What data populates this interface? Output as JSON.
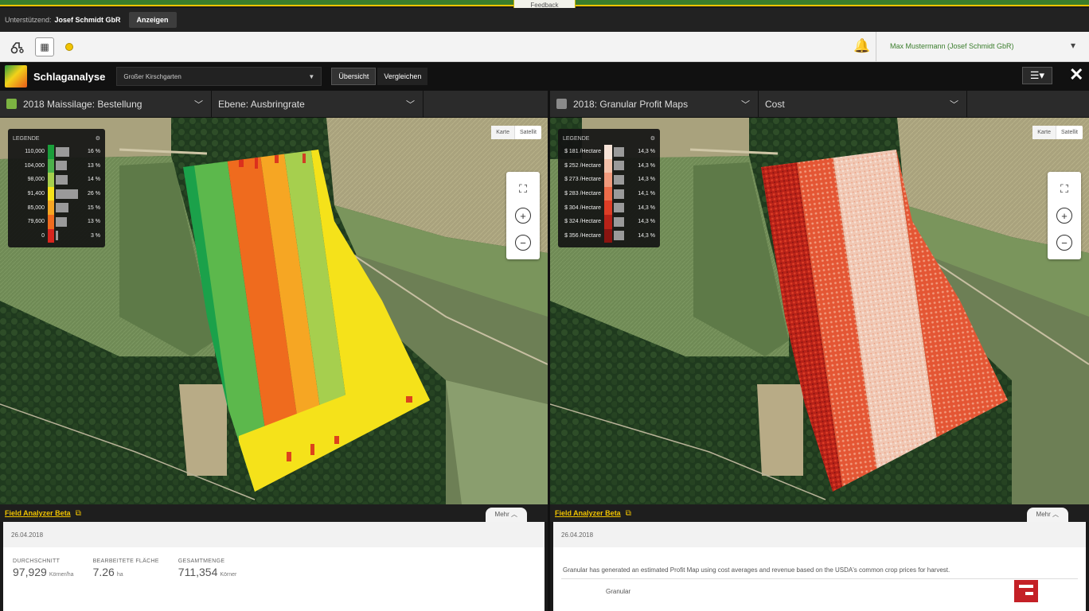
{
  "header": {
    "feedback_label": "Feedback",
    "support_label": "Unterstützend:",
    "org_name": "Josef Schmidt GbR",
    "open_button": "Anzeigen"
  },
  "toolbar": {
    "user": "Max Mustermann (Josef Schmidt GbR)"
  },
  "app": {
    "title": "Schlaganalyse",
    "field_select": "Großer Kirschgarten",
    "tab_overview": "Übersicht",
    "tab_compare": "Vergleichen"
  },
  "left_pane": {
    "layer": "2018 Maissilage: Bestellung",
    "layer_color": "#7cb342",
    "level": "Ebene: Ausbringrate",
    "map_toggle": [
      "Karte",
      "Satellit"
    ],
    "legend": {
      "title": "LEGENDE",
      "rows": [
        {
          "label": "110,000",
          "color": "#1a9e3a",
          "pct_text": "16 %",
          "pct": 16
        },
        {
          "label": "104,000",
          "color": "#4cb04a",
          "pct_text": "13 %",
          "pct": 13
        },
        {
          "label": "98,000",
          "color": "#a6cf4e",
          "pct_text": "14 %",
          "pct": 14
        },
        {
          "label": "91,400",
          "color": "#f5e21a",
          "pct_text": "26 %",
          "pct": 26
        },
        {
          "label": "85,000",
          "color": "#f6a623",
          "pct_text": "15 %",
          "pct": 15
        },
        {
          "label": "79,600",
          "color": "#ef6b1e",
          "pct_text": "13 %",
          "pct": 13
        },
        {
          "label": "0",
          "color": "#d7261e",
          "pct_text": "3 %",
          "pct": 3
        }
      ]
    },
    "link": "Field Analyzer Beta",
    "more": "Mehr",
    "date": "26.04.2018",
    "stats": [
      {
        "label": "DURCHSCHNITT",
        "value": "97,929",
        "unit": "Körner/ha"
      },
      {
        "label": "BEARBEITETE FLÄCHE",
        "value": "7.26",
        "unit": "ha"
      },
      {
        "label": "GESAMTMENGE",
        "value": "711,354",
        "unit": "Körner"
      }
    ]
  },
  "right_pane": {
    "layer": "2018: Granular Profit Maps",
    "layer_color": "#8a8a8a",
    "level": "Cost",
    "map_toggle": [
      "Karte",
      "Satellit"
    ],
    "legend": {
      "title": "LEGENDE",
      "rows": [
        {
          "label": "$ 181 /Hectare",
          "color": "#f7e4d8",
          "pct_text": "14,3 %",
          "pct": 14.3
        },
        {
          "label": "$ 252 /Hectare",
          "color": "#f4c2aa",
          "pct_text": "14,3 %",
          "pct": 14.3
        },
        {
          "label": "$ 273 /Hectare",
          "color": "#f19a7c",
          "pct_text": "14,3 %",
          "pct": 14.3
        },
        {
          "label": "$ 283 /Hectare",
          "color": "#ec6c4a",
          "pct_text": "14,1 %",
          "pct": 14.1
        },
        {
          "label": "$ 304 /Hectare",
          "color": "#de3d26",
          "pct_text": "14,3 %",
          "pct": 14.3
        },
        {
          "label": "$ 324 /Hectare",
          "color": "#b82218",
          "pct_text": "14,3 %",
          "pct": 14.3
        },
        {
          "label": "$ 356 /Hectare",
          "color": "#8a1410",
          "pct_text": "14,3 %",
          "pct": 14.3
        }
      ]
    },
    "link": "Field Analyzer Beta",
    "more": "Mehr",
    "date": "26.04.2018",
    "description": "Granular has generated an estimated Profit Map using cost averages and revenue based on the USDA's common crop prices for harvest.",
    "brand": "Granular"
  }
}
